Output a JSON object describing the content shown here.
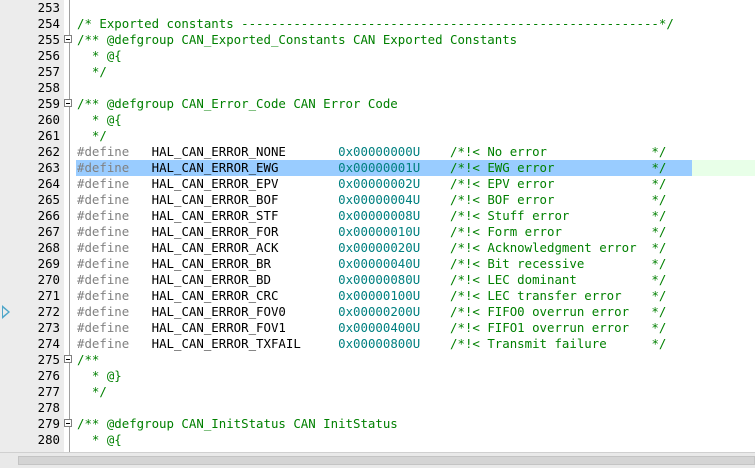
{
  "colors": {
    "comment": "#008000",
    "directive": "#808080",
    "number": "#008080",
    "identifier": "#000000",
    "selection": "#99ccff",
    "current_line": "#e8ffe8",
    "fold_guide": "#a0a0a0"
  },
  "editor": {
    "selected_line": "263",
    "lines": [
      {
        "num": "253",
        "fold": false,
        "tokens": []
      },
      {
        "num": "254",
        "fold": false,
        "tokens": [
          {
            "t": "c",
            "v": "/* Exported constants --------------------------------------------------------*/"
          }
        ]
      },
      {
        "num": "255",
        "fold": true,
        "tokens": [
          {
            "t": "c",
            "v": "/** @defgroup CAN_Exported_Constants CAN Exported Constants"
          }
        ]
      },
      {
        "num": "256",
        "fold": false,
        "tokens": [
          {
            "t": "c",
            "v": "  * @{"
          }
        ]
      },
      {
        "num": "257",
        "fold": false,
        "tokens": [
          {
            "t": "c",
            "v": "  */"
          }
        ]
      },
      {
        "num": "258",
        "fold": false,
        "tokens": []
      },
      {
        "num": "259",
        "fold": true,
        "tokens": [
          {
            "t": "c",
            "v": "/** @defgroup CAN_Error_Code CAN Error Code"
          }
        ]
      },
      {
        "num": "260",
        "fold": false,
        "tokens": [
          {
            "t": "c",
            "v": "  * @{"
          }
        ]
      },
      {
        "num": "261",
        "fold": false,
        "tokens": [
          {
            "t": "c",
            "v": "  */"
          }
        ]
      },
      {
        "num": "262",
        "fold": false,
        "tokens": [
          {
            "t": "d",
            "v": "#define"
          },
          {
            "t": "s",
            "v": "   "
          },
          {
            "t": "i",
            "v": "HAL_CAN_ERROR_NONE"
          },
          {
            "t": "s",
            "v": "       "
          },
          {
            "t": "n",
            "v": "0x00000000U"
          },
          {
            "t": "s",
            "v": "    "
          },
          {
            "t": "c",
            "v": "/*!< No error              */"
          }
        ]
      },
      {
        "num": "263",
        "fold": false,
        "tokens": [
          {
            "t": "d",
            "v": "#define"
          },
          {
            "t": "s",
            "v": "   "
          },
          {
            "t": "i",
            "v": "HAL_CAN_ERROR_EWG"
          },
          {
            "t": "s",
            "v": "        "
          },
          {
            "t": "n",
            "v": "0x00000001U"
          },
          {
            "t": "s",
            "v": "    "
          },
          {
            "t": "c",
            "v": "/*!< EWG error             */"
          }
        ]
      },
      {
        "num": "264",
        "fold": false,
        "tokens": [
          {
            "t": "d",
            "v": "#define"
          },
          {
            "t": "s",
            "v": "   "
          },
          {
            "t": "i",
            "v": "HAL_CAN_ERROR_EPV"
          },
          {
            "t": "s",
            "v": "        "
          },
          {
            "t": "n",
            "v": "0x00000002U"
          },
          {
            "t": "s",
            "v": "    "
          },
          {
            "t": "c",
            "v": "/*!< EPV error             */"
          }
        ]
      },
      {
        "num": "265",
        "fold": false,
        "tokens": [
          {
            "t": "d",
            "v": "#define"
          },
          {
            "t": "s",
            "v": "   "
          },
          {
            "t": "i",
            "v": "HAL_CAN_ERROR_BOF"
          },
          {
            "t": "s",
            "v": "        "
          },
          {
            "t": "n",
            "v": "0x00000004U"
          },
          {
            "t": "s",
            "v": "    "
          },
          {
            "t": "c",
            "v": "/*!< BOF error             */"
          }
        ]
      },
      {
        "num": "266",
        "fold": false,
        "tokens": [
          {
            "t": "d",
            "v": "#define"
          },
          {
            "t": "s",
            "v": "   "
          },
          {
            "t": "i",
            "v": "HAL_CAN_ERROR_STF"
          },
          {
            "t": "s",
            "v": "        "
          },
          {
            "t": "n",
            "v": "0x00000008U"
          },
          {
            "t": "s",
            "v": "    "
          },
          {
            "t": "c",
            "v": "/*!< Stuff error           */"
          }
        ]
      },
      {
        "num": "267",
        "fold": false,
        "tokens": [
          {
            "t": "d",
            "v": "#define"
          },
          {
            "t": "s",
            "v": "   "
          },
          {
            "t": "i",
            "v": "HAL_CAN_ERROR_FOR"
          },
          {
            "t": "s",
            "v": "        "
          },
          {
            "t": "n",
            "v": "0x00000010U"
          },
          {
            "t": "s",
            "v": "    "
          },
          {
            "t": "c",
            "v": "/*!< Form error            */"
          }
        ]
      },
      {
        "num": "268",
        "fold": false,
        "tokens": [
          {
            "t": "d",
            "v": "#define"
          },
          {
            "t": "s",
            "v": "   "
          },
          {
            "t": "i",
            "v": "HAL_CAN_ERROR_ACK"
          },
          {
            "t": "s",
            "v": "        "
          },
          {
            "t": "n",
            "v": "0x00000020U"
          },
          {
            "t": "s",
            "v": "    "
          },
          {
            "t": "c",
            "v": "/*!< Acknowledgment error  */"
          }
        ]
      },
      {
        "num": "269",
        "fold": false,
        "tokens": [
          {
            "t": "d",
            "v": "#define"
          },
          {
            "t": "s",
            "v": "   "
          },
          {
            "t": "i",
            "v": "HAL_CAN_ERROR_BR"
          },
          {
            "t": "s",
            "v": "         "
          },
          {
            "t": "n",
            "v": "0x00000040U"
          },
          {
            "t": "s",
            "v": "    "
          },
          {
            "t": "c",
            "v": "/*!< Bit recessive         */"
          }
        ]
      },
      {
        "num": "270",
        "fold": false,
        "tokens": [
          {
            "t": "d",
            "v": "#define"
          },
          {
            "t": "s",
            "v": "   "
          },
          {
            "t": "i",
            "v": "HAL_CAN_ERROR_BD"
          },
          {
            "t": "s",
            "v": "         "
          },
          {
            "t": "n",
            "v": "0x00000080U"
          },
          {
            "t": "s",
            "v": "    "
          },
          {
            "t": "c",
            "v": "/*!< LEC dominant          */"
          }
        ]
      },
      {
        "num": "271",
        "fold": false,
        "tokens": [
          {
            "t": "d",
            "v": "#define"
          },
          {
            "t": "s",
            "v": "   "
          },
          {
            "t": "i",
            "v": "HAL_CAN_ERROR_CRC"
          },
          {
            "t": "s",
            "v": "        "
          },
          {
            "t": "n",
            "v": "0x00000100U"
          },
          {
            "t": "s",
            "v": "    "
          },
          {
            "t": "c",
            "v": "/*!< LEC transfer error    */"
          }
        ]
      },
      {
        "num": "272",
        "fold": false,
        "tokens": [
          {
            "t": "d",
            "v": "#define"
          },
          {
            "t": "s",
            "v": "   "
          },
          {
            "t": "i",
            "v": "HAL_CAN_ERROR_FOV0"
          },
          {
            "t": "s",
            "v": "       "
          },
          {
            "t": "n",
            "v": "0x00000200U"
          },
          {
            "t": "s",
            "v": "    "
          },
          {
            "t": "c",
            "v": "/*!< FIFO0 overrun error   */"
          }
        ]
      },
      {
        "num": "273",
        "fold": false,
        "tokens": [
          {
            "t": "d",
            "v": "#define"
          },
          {
            "t": "s",
            "v": "   "
          },
          {
            "t": "i",
            "v": "HAL_CAN_ERROR_FOV1"
          },
          {
            "t": "s",
            "v": "       "
          },
          {
            "t": "n",
            "v": "0x00000400U"
          },
          {
            "t": "s",
            "v": "    "
          },
          {
            "t": "c",
            "v": "/*!< FIFO1 overrun error   */"
          }
        ]
      },
      {
        "num": "274",
        "fold": false,
        "tokens": [
          {
            "t": "d",
            "v": "#define"
          },
          {
            "t": "s",
            "v": "   "
          },
          {
            "t": "i",
            "v": "HAL_CAN_ERROR_TXFAIL"
          },
          {
            "t": "s",
            "v": "     "
          },
          {
            "t": "n",
            "v": "0x00000800U"
          },
          {
            "t": "s",
            "v": "    "
          },
          {
            "t": "c",
            "v": "/*!< Transmit failure      */"
          }
        ]
      },
      {
        "num": "275",
        "fold": true,
        "tokens": [
          {
            "t": "c",
            "v": "/**"
          }
        ]
      },
      {
        "num": "276",
        "fold": false,
        "tokens": [
          {
            "t": "c",
            "v": "  * @}"
          }
        ]
      },
      {
        "num": "277",
        "fold": false,
        "tokens": [
          {
            "t": "c",
            "v": "  */"
          }
        ]
      },
      {
        "num": "278",
        "fold": false,
        "tokens": []
      },
      {
        "num": "279",
        "fold": true,
        "tokens": [
          {
            "t": "c",
            "v": "/** @defgroup CAN_InitStatus CAN InitStatus"
          }
        ]
      },
      {
        "num": "280",
        "fold": false,
        "tokens": [
          {
            "t": "c",
            "v": "  * @{"
          }
        ]
      }
    ]
  }
}
